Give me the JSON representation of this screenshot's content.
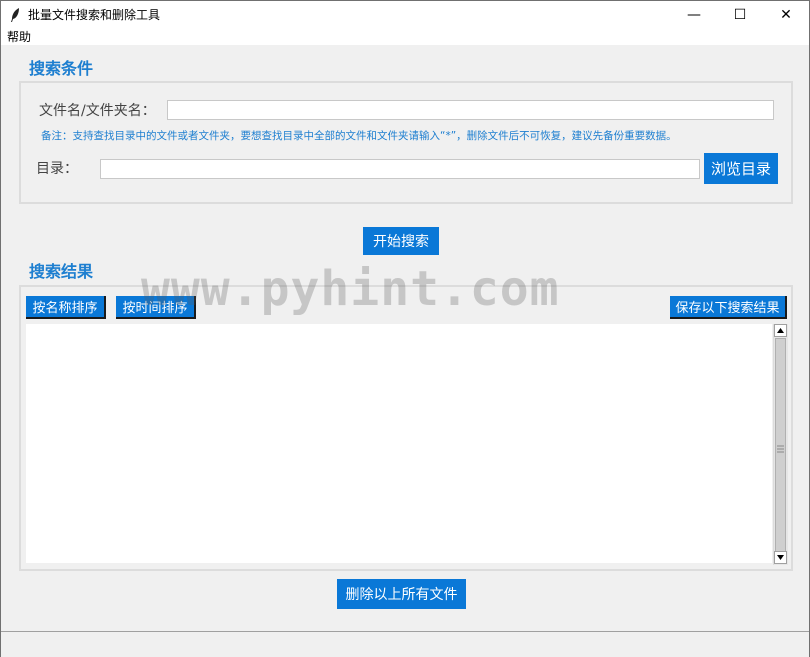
{
  "window": {
    "title": "批量文件搜索和删除工具",
    "minimize_glyph": "—",
    "maximize_glyph": "☐",
    "close_glyph": "✕"
  },
  "menu": {
    "items": [
      {
        "label": "帮助"
      }
    ]
  },
  "search_conditions": {
    "title": "搜索条件",
    "filename_label": "文件名/文件夹名：",
    "filename_value": "",
    "note": "备注：支持查找目录中的文件或者文件夹，要想查找目录中全部的文件和文件夹请输入“*”，删除文件后不可恢复，建议先备份重要数据。",
    "directory_label": "目录：",
    "directory_value": "",
    "browse_button": "浏览目录"
  },
  "start_search_button": "开始搜索",
  "search_results": {
    "title": "搜索结果",
    "sort_by_name_button": "按名称排序",
    "sort_by_time_button": "按时间排序",
    "save_results_button": "保存以下搜索结果",
    "items": []
  },
  "delete_all_button": "删除以上所有文件",
  "watermark": "www.pyhint.com",
  "colors": {
    "accent": "#0a78d7",
    "section_title": "#1e7fd0"
  },
  "icons": {
    "app": "feather-icon",
    "scroll_up": "chevron-up-icon",
    "scroll_down": "chevron-down-icon"
  }
}
